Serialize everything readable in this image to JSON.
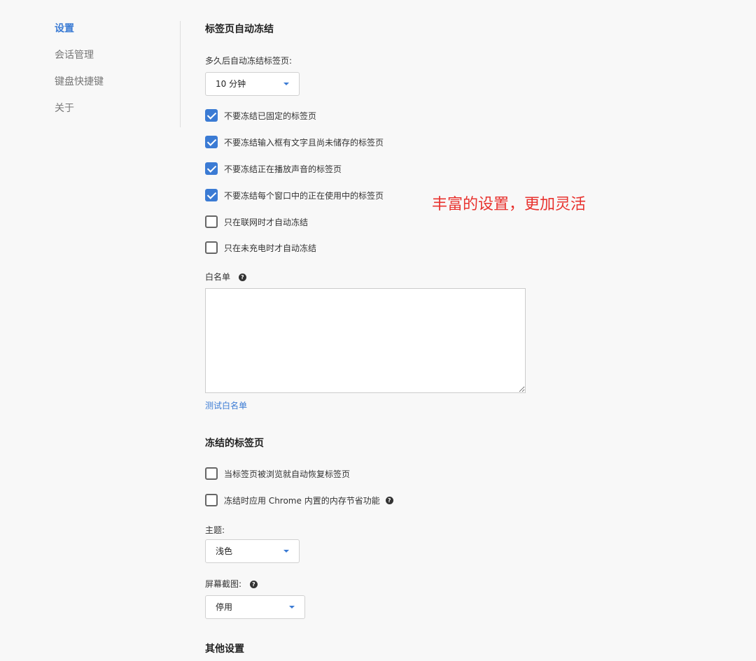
{
  "sidebar": {
    "items": [
      {
        "label": "设置",
        "active": true
      },
      {
        "label": "会话管理"
      },
      {
        "label": "键盘快捷键"
      },
      {
        "label": "关于"
      }
    ]
  },
  "auto_freeze": {
    "title": "标签页自动冻结",
    "delay_label": "多久后自动冻结标签页:",
    "delay_value": "10 分钟",
    "options": [
      {
        "label": "不要冻结已固定的标签页",
        "checked": true
      },
      {
        "label": "不要冻结输入框有文字且尚未储存的标签页",
        "checked": true
      },
      {
        "label": "不要冻结正在播放声音的标签页",
        "checked": true
      },
      {
        "label": "不要冻结每个窗口中的正在使用中的标签页",
        "checked": true
      },
      {
        "label": "只在联网时才自动冻结",
        "checked": false
      },
      {
        "label": "只在未充电时才自动冻结",
        "checked": false
      }
    ],
    "whitelist_label": "白名单",
    "whitelist_value": "",
    "test_whitelist_link": "测试白名单"
  },
  "frozen_tabs": {
    "title": "冻结的标签页",
    "options": [
      {
        "label": "当标签页被浏览就自动恢复标签页",
        "checked": false
      },
      {
        "label": "冻结时应用 Chrome 内置的内存节省功能",
        "checked": false,
        "help": true
      }
    ],
    "theme_label": "主题:",
    "theme_value": "浅色",
    "screenshot_label": "屏幕截图:",
    "screenshot_value": "停用"
  },
  "other": {
    "title": "其他设置"
  },
  "promo_text": "丰富的设置，更加灵活",
  "colors": {
    "accent": "#3b7bd4",
    "promo": "#e8322e"
  },
  "icons": {
    "help": "?"
  }
}
